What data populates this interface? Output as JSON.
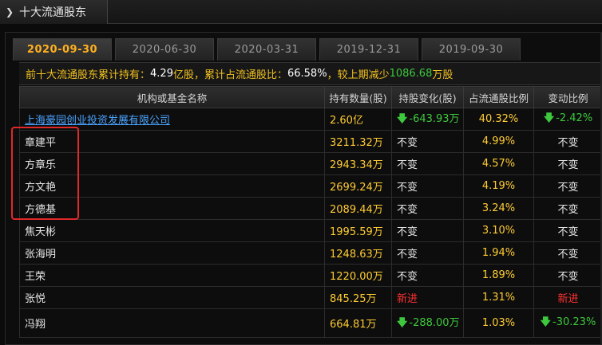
{
  "panel": {
    "title": "十大流通股东"
  },
  "tabs": [
    {
      "label": "2020-09-30",
      "active": true
    },
    {
      "label": "2020-06-30",
      "active": false
    },
    {
      "label": "2020-03-31",
      "active": false
    },
    {
      "label": "2019-12-31",
      "active": false
    },
    {
      "label": "2019-09-30",
      "active": false
    }
  ],
  "summary": {
    "prefix": "前十大流通股东累计持有：",
    "total": "4.29",
    "total_unit": "亿股，累计占流通股比：",
    "ratio": "66.58%",
    "mid": "，较上期减少",
    "decrease": "1086.68",
    "decrease_unit": "万股"
  },
  "table": {
    "headers": [
      "机构或基金名称",
      "持有数量(股)",
      "持股变化(股)",
      "占流通股比例",
      "变动比例"
    ],
    "rows": [
      {
        "name": "上海豪园创业投资发展有限公司",
        "link": true,
        "qty": "2.60亿",
        "change": "-643.93万",
        "change_type": "down",
        "ratio": "40.32%",
        "var": "-2.42%",
        "var_type": "down"
      },
      {
        "name": "章建平",
        "link": false,
        "qty": "3211.32万",
        "change": "不变",
        "change_type": "same",
        "ratio": "4.99%",
        "var": "不变",
        "var_type": "same"
      },
      {
        "name": "方章乐",
        "link": false,
        "qty": "2943.34万",
        "change": "不变",
        "change_type": "same",
        "ratio": "4.57%",
        "var": "不变",
        "var_type": "same"
      },
      {
        "name": "方文艳",
        "link": false,
        "qty": "2699.24万",
        "change": "不变",
        "change_type": "same",
        "ratio": "4.19%",
        "var": "不变",
        "var_type": "same"
      },
      {
        "name": "方德基",
        "link": false,
        "qty": "2089.44万",
        "change": "不变",
        "change_type": "same",
        "ratio": "3.24%",
        "var": "不变",
        "var_type": "same"
      },
      {
        "name": "焦天彬",
        "link": false,
        "qty": "1995.59万",
        "change": "不变",
        "change_type": "same",
        "ratio": "3.10%",
        "var": "不变",
        "var_type": "same"
      },
      {
        "name": "张海明",
        "link": false,
        "qty": "1248.63万",
        "change": "不变",
        "change_type": "same",
        "ratio": "1.94%",
        "var": "不变",
        "var_type": "same"
      },
      {
        "name": "王荣",
        "link": false,
        "qty": "1220.00万",
        "change": "不变",
        "change_type": "same",
        "ratio": "1.89%",
        "var": "不变",
        "var_type": "same"
      },
      {
        "name": "张悦",
        "link": false,
        "qty": "845.25万",
        "change": "新进",
        "change_type": "new",
        "ratio": "1.31%",
        "var": "新进",
        "var_type": "new"
      },
      {
        "name": "冯翔",
        "link": false,
        "qty": "664.81万",
        "change": "-288.00万",
        "change_type": "down",
        "ratio": "1.03%",
        "var": "-30.23%",
        "var_type": "down",
        "tall": true
      }
    ]
  },
  "colors": {
    "accent": "#ffb020",
    "up": "#ff3030",
    "down": "#3ec83e",
    "link": "#4aa3ff",
    "highlight": "#e0282a"
  }
}
